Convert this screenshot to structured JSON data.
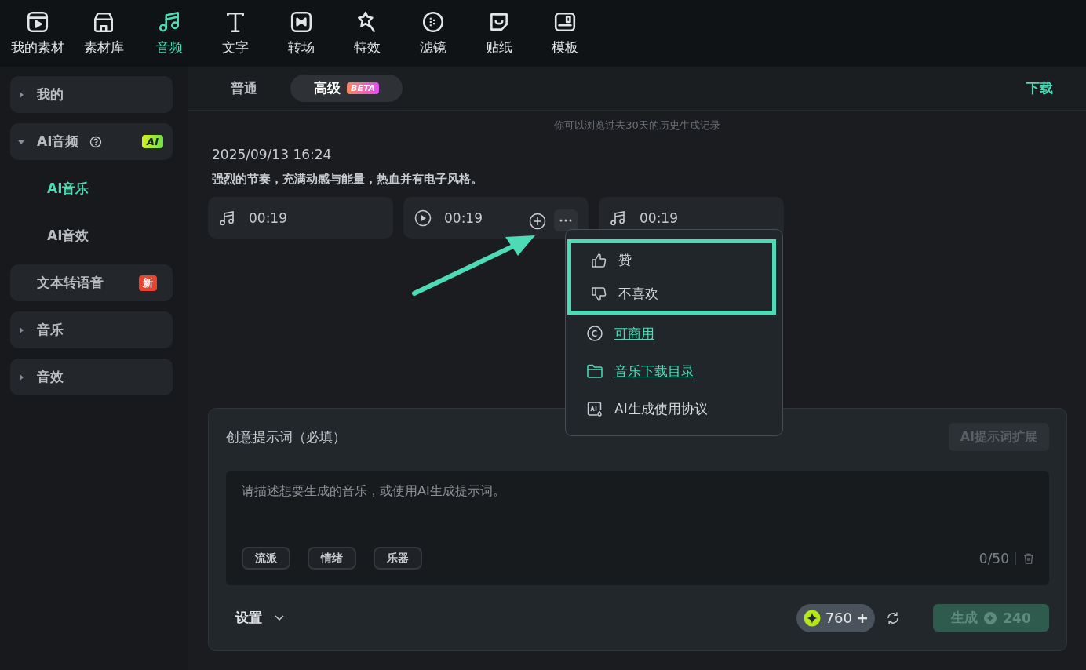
{
  "toolbar": [
    {
      "label": "我的素材",
      "selected": false
    },
    {
      "label": "素材库",
      "selected": false
    },
    {
      "label": "音频",
      "selected": true
    },
    {
      "label": "文字",
      "selected": false
    },
    {
      "label": "转场",
      "selected": false
    },
    {
      "label": "特效",
      "selected": false
    },
    {
      "label": "滤镜",
      "selected": false
    },
    {
      "label": "贴纸",
      "selected": false
    },
    {
      "label": "模板",
      "selected": false
    }
  ],
  "sidebar": [
    {
      "kind": "group",
      "label": "我的",
      "expanded": false
    },
    {
      "kind": "group",
      "label": "AI音频",
      "expanded": true,
      "help": true,
      "badge": {
        "kind": "ai",
        "text": "AI"
      },
      "children": [
        {
          "label": "AI音乐",
          "selected": true
        },
        {
          "label": "AI音效",
          "selected": false
        }
      ]
    },
    {
      "kind": "item",
      "label": "文本转语音",
      "badge": {
        "kind": "new",
        "text": "新"
      }
    },
    {
      "kind": "group",
      "label": "音乐",
      "expanded": false
    },
    {
      "kind": "group",
      "label": "音效",
      "expanded": false
    }
  ],
  "tabs": [
    {
      "label": "普通",
      "selected": false
    },
    {
      "label": "高级",
      "selected": true,
      "badge": "BETA"
    }
  ],
  "download": "下载",
  "history_hint": "你可以浏览过去30天的历史生成记录",
  "record": {
    "date": "2025/09/13 16:24",
    "prompt": "强烈的节奏，充满动感与能量，热血并有电子风格。",
    "tracks": [
      {
        "kind": "note",
        "duration": "00:19",
        "hovered": false
      },
      {
        "kind": "play",
        "duration": "00:19",
        "hovered": true
      },
      {
        "kind": "note",
        "duration": "00:19",
        "hovered": false
      }
    ]
  },
  "menu": {
    "items": [
      {
        "label": "赞",
        "kind": "plain",
        "highlighted": true
      },
      {
        "label": "不喜欢",
        "kind": "plain",
        "highlighted": true
      },
      {
        "label": "可商用",
        "kind": "link",
        "highlighted": false
      },
      {
        "label": "音乐下载目录",
        "kind": "link",
        "highlighted": false
      },
      {
        "label": "AI生成使用协议",
        "kind": "plain",
        "highlighted": false
      }
    ]
  },
  "prompt_panel": {
    "title": "创意提示词（必填）",
    "expand_button": {
      "label": "AI提示词扩展",
      "disabled": true
    },
    "placeholder": "请描述想要生成的音乐，或使用AI生成提示词。",
    "chips": [
      "流派",
      "情绪",
      "乐器"
    ],
    "counter": "0/50",
    "settings": "设置",
    "credits": "760",
    "generate": {
      "label": "生成",
      "cost": "240",
      "disabled": true
    }
  }
}
